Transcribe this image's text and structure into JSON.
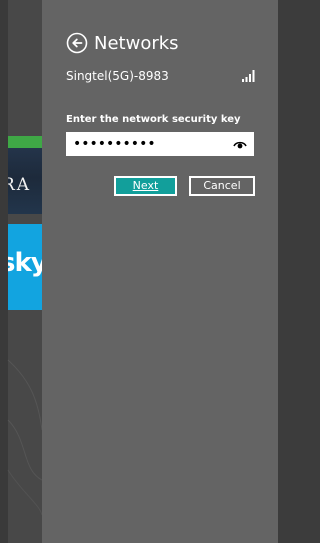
{
  "start_tiles": {
    "ra_tile_text": "RA",
    "sky_tile_text": "sky"
  },
  "networks_panel": {
    "title": "Networks",
    "back_icon": "back-arrow-circle-icon",
    "network_name": "Singtel(5G)-8983",
    "signal_icon": "wifi-signal-bars-icon",
    "security_key_label": "Enter the network security key",
    "security_key_value": "••••••••••",
    "reveal_icon": "eye-reveal-icon",
    "next_label": "Next",
    "cancel_label": "Cancel"
  },
  "colors": {
    "panel_background": "#646464",
    "next_button_accent": "#129f9b",
    "sky_tile": "#12a4e0",
    "green_tile": "#3fa846"
  }
}
